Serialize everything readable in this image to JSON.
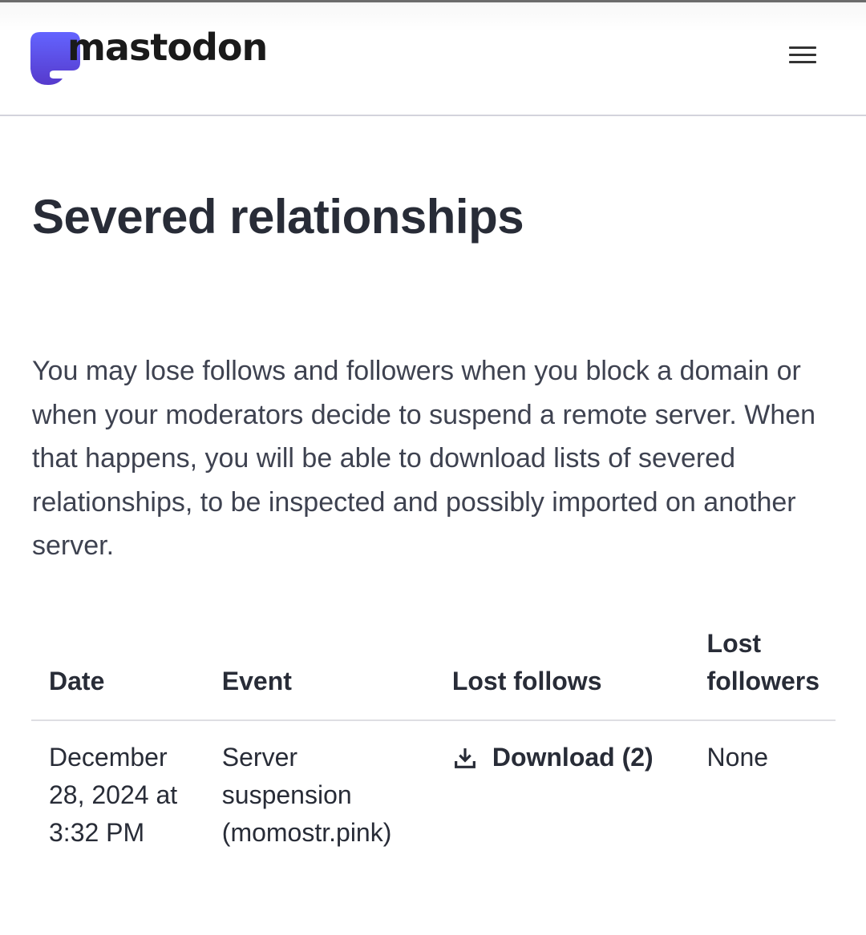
{
  "header": {
    "brand": "mastodon",
    "brand_color": "#6364ff",
    "menu_icon": "hamburger-menu-icon"
  },
  "page": {
    "title": "Severed relationships",
    "intro": "You may lose follows and followers when you block a domain or when your moderators decide to suspend a remote server. When that happens, you will be able to download lists of severed relationships, to be inspected and possibly imported on another server."
  },
  "table": {
    "headers": [
      "Date",
      "Event",
      "Lost follows",
      "Lost followers"
    ],
    "rows": [
      {
        "date": "December 28, 2024 at 3:32 PM",
        "event": "Server suspension (momostr.pink)",
        "lost_follows": {
          "icon": "download-icon",
          "label": "Download (2)"
        },
        "lost_followers": "None"
      }
    ]
  }
}
